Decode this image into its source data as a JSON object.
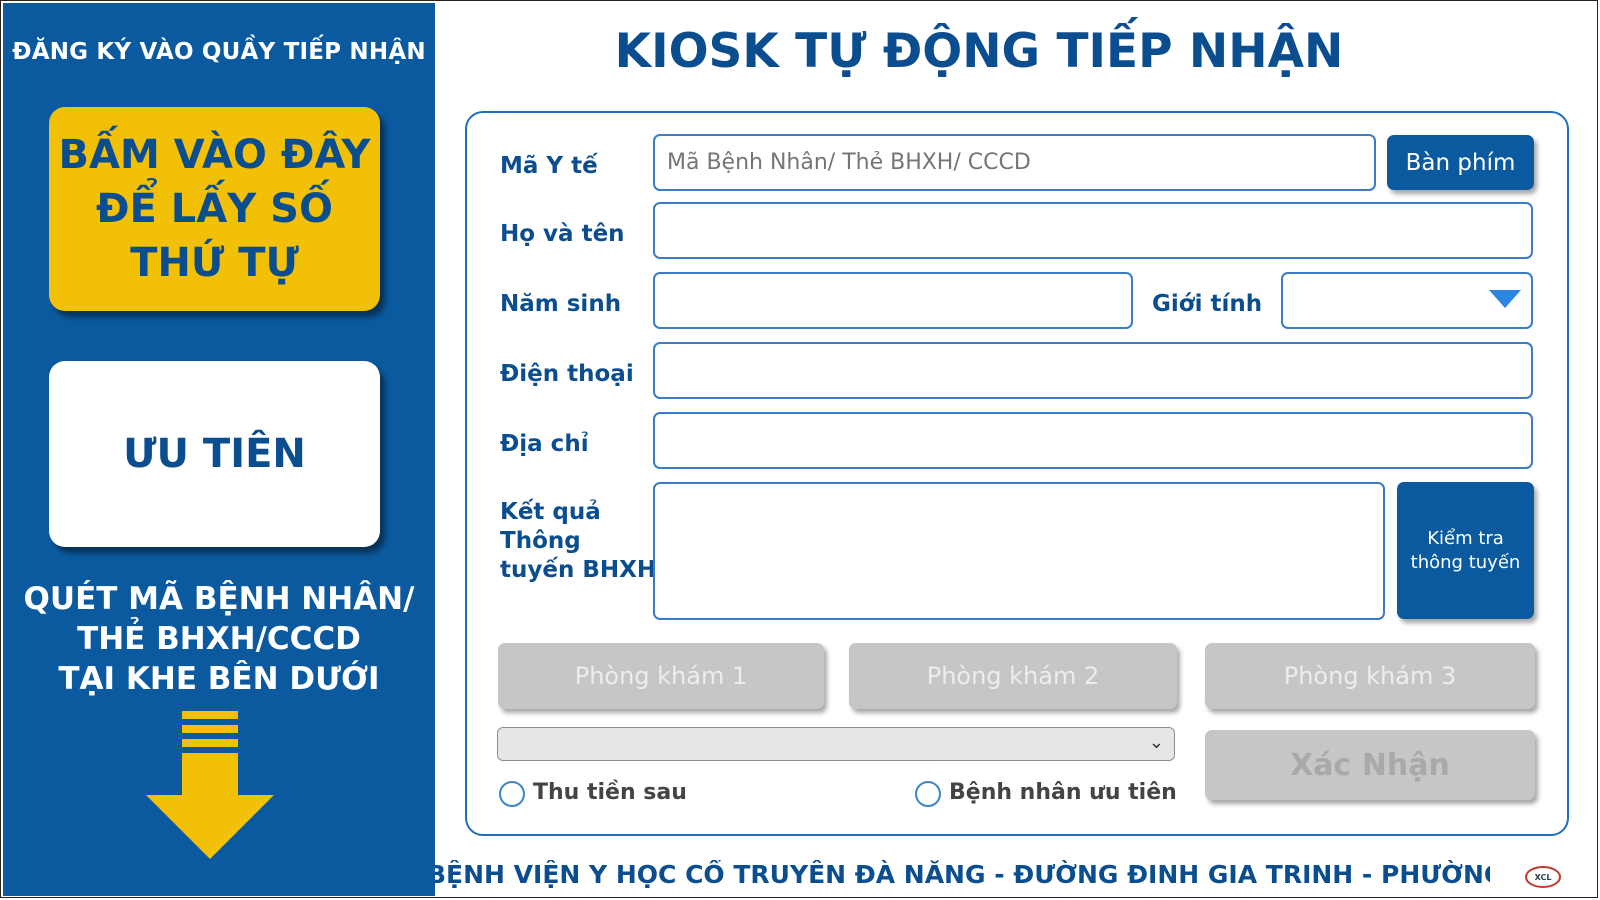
{
  "left_panel": {
    "title": "ĐĂNG KÝ VÀO QUẦY TIẾP NHẬN",
    "get_number_lines": [
      "BẤM VÀO ĐÂY",
      "ĐỂ LẤY SỐ",
      "THỨ TỰ"
    ],
    "priority_label": "ƯU TIÊN",
    "scan_lines": [
      "QUÉT MÃ BỆNH NHÂN/",
      "THẺ BHXH/CCCD",
      "TẠI KHE BÊN DƯỚI"
    ],
    "arrow_icon": "arrow-down-icon",
    "colors": {
      "panel": "#0b5aa0",
      "yellow": "#f2c007"
    }
  },
  "header": {
    "title": "KIOSK TỰ ĐỘNG TIẾP NHẬN"
  },
  "form": {
    "ma_y_te": {
      "label": "Mã Y tế",
      "placeholder": "Mã Bệnh Nhân/ Thẻ BHXH/ CCCD",
      "value": ""
    },
    "keyboard_button": "Bàn phím",
    "ho_va_ten": {
      "label": "Họ và tên",
      "value": ""
    },
    "nam_sinh": {
      "label": "Năm sinh",
      "value": ""
    },
    "gioi_tinh": {
      "label": "Giới tính",
      "value": ""
    },
    "dien_thoai": {
      "label": "Điện thoại",
      "value": ""
    },
    "dia_chi": {
      "label": "Địa chỉ",
      "value": ""
    },
    "ket_qua": {
      "label_lines": [
        "Kết quả",
        "Thông",
        "tuyến BHXH"
      ],
      "value": ""
    },
    "check_button_lines": [
      "Kiểm tra",
      "thông tuyến"
    ],
    "rooms": [
      "Phòng khám 1",
      "Phòng khám 2",
      "Phòng khám 3"
    ],
    "select_value": "",
    "confirm_button": "Xác Nhận",
    "radio_pay_later": "Thu tiền sau",
    "radio_priority_patient": "Bệnh nhân ưu tiên"
  },
  "footer": {
    "marquee": "BỆNH VIỆN Y HỌC CỔ TRUYỀN ĐÀ NẴNG - ĐƯỜNG ĐINH GIA TRINH - PHƯỜNG HÒA XUÂN",
    "logo_text": "XCL"
  }
}
